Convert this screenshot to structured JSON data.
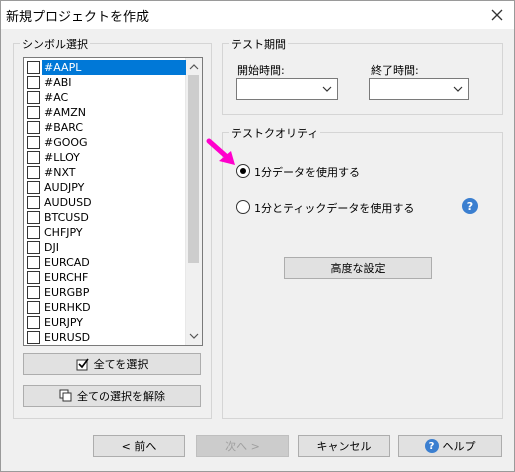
{
  "window": {
    "title": "新規プロジェクトを作成"
  },
  "symbols": {
    "group_label": "シンボル選択",
    "items": [
      "#AAPL",
      "#ABI",
      "#AC",
      "#AMZN",
      "#BARC",
      "#GOOG",
      "#LLOY",
      "#NXT",
      "AUDJPY",
      "AUDUSD",
      "BTCUSD",
      "CHFJPY",
      "DJI",
      "EURCAD",
      "EURCHF",
      "EURGBP",
      "EURHKD",
      "EURJPY",
      "EURUSD"
    ],
    "selected": "#AAPL",
    "select_all": "全てを選択",
    "deselect_all": "全ての選択を解除"
  },
  "period": {
    "group_label": "テスト期間",
    "start_label": "開始時間:",
    "end_label": "終了時間:",
    "start_value": "",
    "end_value": ""
  },
  "quality": {
    "group_label": "テストクオリティ",
    "option1": "1分データを使用する",
    "option2": "1分とティックデータを使用する",
    "selected": "option1",
    "advanced": "高度な設定",
    "help_glyph": "?"
  },
  "footer": {
    "prev": "< 前へ",
    "next": "次へ >",
    "cancel": "キャンセル",
    "help": "ヘルプ"
  },
  "colors": {
    "accent": "#0078d7",
    "annotation_arrow": "#ff00cc"
  }
}
